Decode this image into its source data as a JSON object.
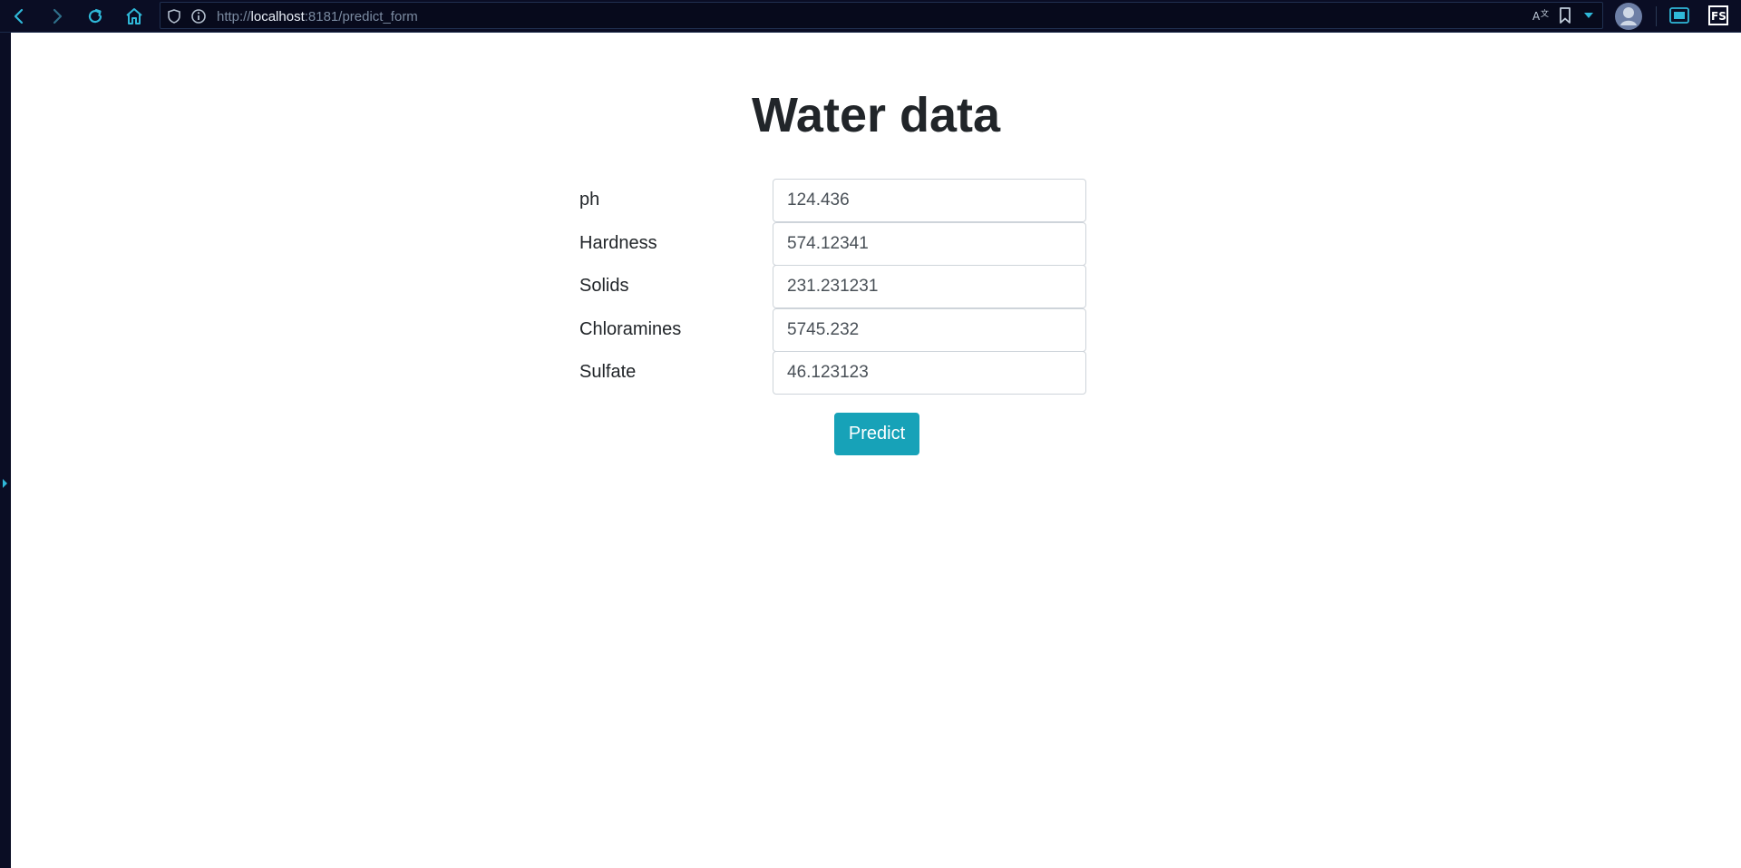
{
  "browser": {
    "url_scheme": "http://",
    "url_host": "localhost",
    "url_path": ":8181/predict_form"
  },
  "icons": {
    "back": "chevron-left-icon",
    "forward": "chevron-right-icon",
    "reload": "reload-icon",
    "home": "home-icon",
    "shield": "shield-icon",
    "info": "info-icon",
    "translate": "translate-icon",
    "bookmark": "bookmark-icon",
    "dropdown": "caret-down-icon",
    "profile": "profile-avatar-icon",
    "extension": "extension-icon",
    "fs": "fs-icon"
  },
  "colors": {
    "accent": "#17a2b8",
    "browser_chrome": "#0a0d24",
    "browser_icon": "#2fb8d8"
  },
  "page": {
    "title": "Water data"
  },
  "form": {
    "fields": [
      {
        "label": "ph",
        "value": "124.436"
      },
      {
        "label": "Hardness",
        "value": "574.12341"
      },
      {
        "label": "Solids",
        "value": "231.231231"
      },
      {
        "label": "Chloramines",
        "value": "5745.232"
      },
      {
        "label": "Sulfate",
        "value": "46.123123"
      }
    ],
    "submit_label": "Predict"
  }
}
